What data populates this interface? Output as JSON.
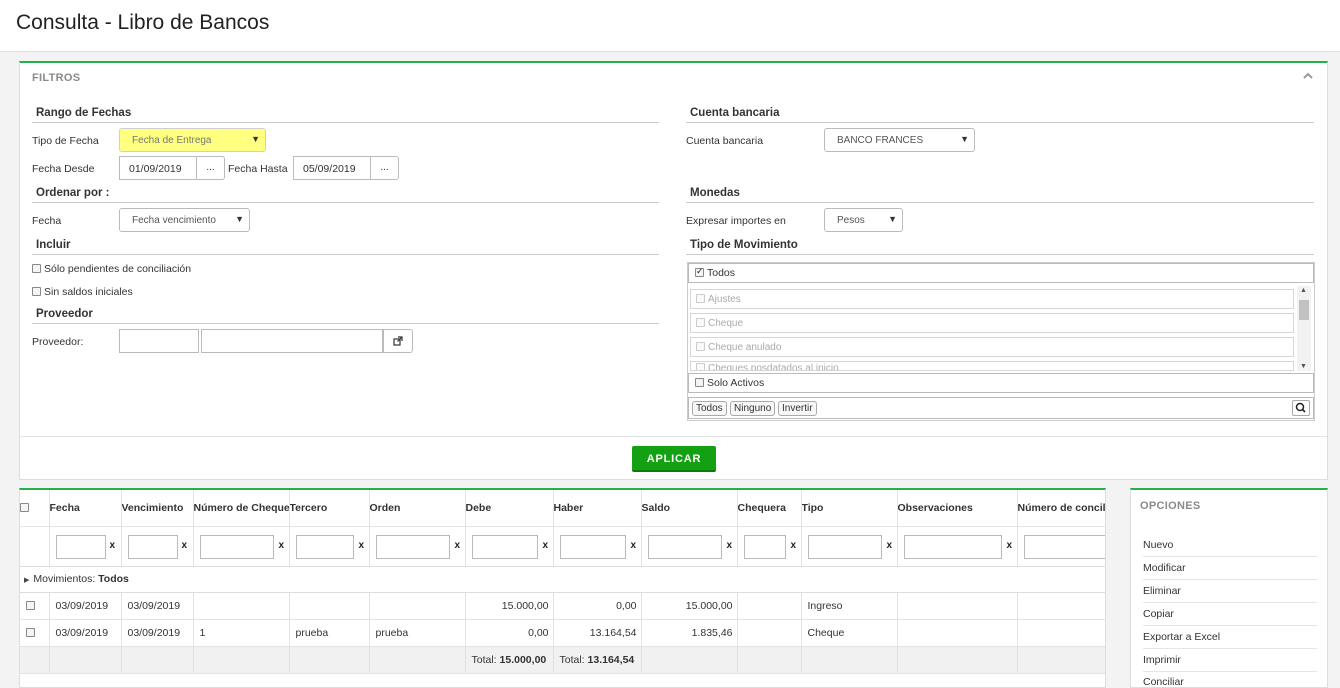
{
  "page": {
    "title": "Consulta - Libro de Bancos"
  },
  "filters": {
    "title": "FILTROS",
    "rango": {
      "heading": "Rango de Fechas",
      "tipo_label": "Tipo de Fecha",
      "tipo_value": "Fecha de Entrega",
      "desde_label": "Fecha Desde",
      "desde_value": "01/09/2019",
      "hasta_label": "Fecha Hasta",
      "hasta_value": "05/09/2019",
      "dots": "..."
    },
    "ordenar": {
      "heading": "Ordenar por :",
      "fecha_label": "Fecha",
      "fecha_value": "Fecha vencimiento"
    },
    "incluir": {
      "heading": "Incluir",
      "opt1": "Sólo pendientes de conciliación",
      "opt2": "Sin saldos iniciales"
    },
    "proveedor": {
      "heading": "Proveedor",
      "label": "Proveedor:"
    },
    "cuenta": {
      "heading": "Cuenta bancaria",
      "label": "Cuenta bancaria",
      "value": "BANCO FRANCES"
    },
    "monedas": {
      "heading": "Monedas",
      "label": "Expresar importes en",
      "value": "Pesos"
    },
    "movimiento": {
      "heading": "Tipo de Movimiento",
      "todos": "Todos",
      "items": [
        "Ajustes",
        "Cheque",
        "Cheque anulado",
        "Cheques posdatados al inicio"
      ],
      "solo_activos": "Solo Activos",
      "btn_todos": "Todos",
      "btn_ninguno": "Ninguno",
      "btn_invertir": "Invertir"
    },
    "apply": "APLICAR"
  },
  "grid": {
    "columns": [
      "Fecha",
      "Vencimiento",
      "Número de Cheque",
      "Tercero",
      "Orden",
      "Debe",
      "Haber",
      "Saldo",
      "Chequera",
      "Tipo",
      "Observaciones",
      "Número de conciliación"
    ],
    "clear_x": "x",
    "group": {
      "label": "Movimientos:",
      "value": "Todos"
    },
    "rows": [
      {
        "fecha": "03/09/2019",
        "venc": "03/09/2019",
        "cheque": "",
        "tercero": "",
        "orden": "",
        "debe": "15.000,00",
        "haber": "0,00",
        "saldo": "15.000,00",
        "chequera": "",
        "tipo": "Ingreso"
      },
      {
        "fecha": "03/09/2019",
        "venc": "03/09/2019",
        "cheque": "1",
        "tercero": "prueba",
        "orden": "prueba",
        "debe": "0,00",
        "haber": "13.164,54",
        "saldo": "1.835,46",
        "chequera": "",
        "tipo": "Cheque"
      }
    ],
    "totals": {
      "label": "Total:",
      "debe": "15.000,00",
      "haber": "13.164,54"
    }
  },
  "options": {
    "title": "OPCIONES",
    "items": [
      "Nuevo",
      "Modificar",
      "Eliminar",
      "Copiar",
      "Exportar a Excel",
      "Imprimir",
      "Conciliar"
    ]
  },
  "colors": {
    "accent": "#22b14c",
    "apply": "#13a013",
    "highlight": "#ffff80"
  }
}
